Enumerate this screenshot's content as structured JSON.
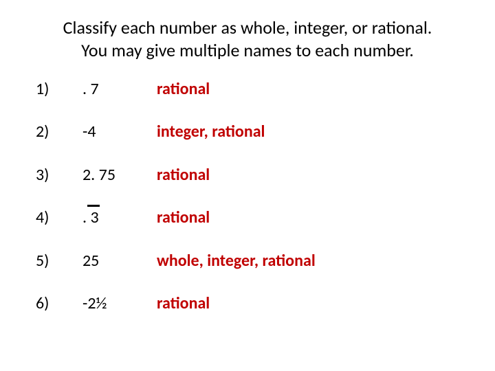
{
  "title": {
    "line1": "Classify each number as whole, integer, or rational.",
    "line2": "You may give multiple names to each number."
  },
  "rows": [
    {
      "label": "1)",
      "number": ". 7",
      "answer": "rational",
      "overline": false
    },
    {
      "label": "2)",
      "number": "-4",
      "answer": "integer, rational",
      "overline": false
    },
    {
      "label": "3)",
      "number": "2. 75",
      "answer": "rational",
      "overline": false
    },
    {
      "label": "4)",
      "number": ". 3",
      "answer": "rational",
      "overline": true
    },
    {
      "label": "5)",
      "number": "25",
      "answer": "whole, integer, rational",
      "overline": false
    },
    {
      "label": "6)",
      "number": "-2½",
      "answer": "rational",
      "overline": false
    }
  ]
}
